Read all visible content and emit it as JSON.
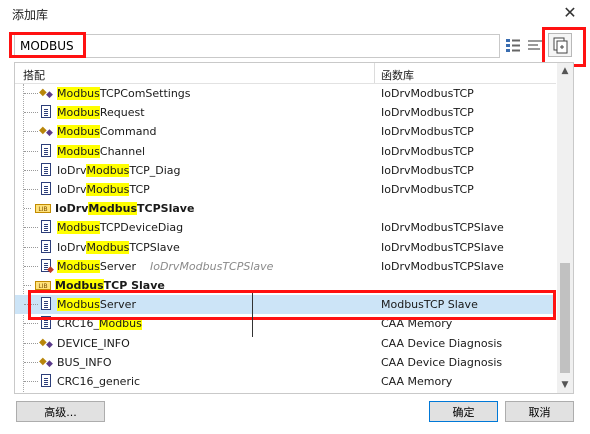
{
  "window": {
    "title": "添加库",
    "close_glyph": "✕"
  },
  "search": {
    "value": "MODBUS"
  },
  "columns": {
    "name": "搭配",
    "library": "函数库"
  },
  "rows": [
    {
      "prefix": "",
      "match": "Modbus",
      "suffix": "TCPComSettings",
      "library": "IoDrvModbusTCP",
      "icon": "function-block-icon",
      "bold": false
    },
    {
      "prefix": "",
      "match": "Modbus",
      "suffix": "Request",
      "library": "IoDrvModbusTCP",
      "icon": "document-icon",
      "bold": false
    },
    {
      "prefix": "",
      "match": "Modbus",
      "suffix": "Command",
      "library": "IoDrvModbusTCP",
      "icon": "function-block-icon",
      "bold": false
    },
    {
      "prefix": "",
      "match": "Modbus",
      "suffix": "Channel",
      "library": "IoDrvModbusTCP",
      "icon": "document-icon",
      "bold": false
    },
    {
      "prefix": "IoDrv",
      "match": "Modbus",
      "suffix": "TCP_Diag",
      "library": "IoDrvModbusTCP",
      "icon": "document-icon",
      "bold": false
    },
    {
      "prefix": "IoDrv",
      "match": "Modbus",
      "suffix": "TCP",
      "library": "IoDrvModbusTCP",
      "icon": "document-icon",
      "bold": false
    },
    {
      "prefix": "IoDrv",
      "match": "Modbus",
      "suffix": "TCPSlave",
      "library": "",
      "icon": "library-icon",
      "bold": true
    },
    {
      "prefix": "",
      "match": "Modbus",
      "suffix": "TCPDeviceDiag",
      "library": "IoDrvModbusTCPSlave",
      "icon": "document-icon",
      "bold": false
    },
    {
      "prefix": "IoDrv",
      "match": "Modbus",
      "suffix": "TCPSlave",
      "library": "IoDrvModbusTCPSlave",
      "icon": "document-icon",
      "bold": false
    },
    {
      "prefix": "",
      "match": "Modbus",
      "suffix": "Server",
      "sub": "IoDrvModbusTCPSlave",
      "library": "IoDrvModbusTCPSlave",
      "icon": "program-icon",
      "bold": false
    },
    {
      "prefix": "",
      "match": "Modbus",
      "suffix": "TCP Slave",
      "library": "",
      "icon": "library-icon",
      "bold": true
    },
    {
      "prefix": "",
      "match": "Modbus",
      "suffix": "Server",
      "library": "ModbusTCP Slave",
      "icon": "document-icon",
      "bold": false,
      "selected": true
    },
    {
      "prefix": "CRC16_",
      "match": "Modbus",
      "suffix": "",
      "library": "CAA Memory",
      "icon": "document-icon",
      "bold": false
    },
    {
      "prefix": "DEVICE_INFO",
      "match": "",
      "suffix": "",
      "library": "CAA Device Diagnosis",
      "icon": "function-block-icon",
      "bold": false
    },
    {
      "prefix": "BUS_INFO",
      "match": "",
      "suffix": "",
      "library": "CAA Device Diagnosis",
      "icon": "function-block-icon",
      "bold": false
    },
    {
      "prefix": "CRC16_generic",
      "match": "",
      "suffix": "",
      "library": "CAA Memory",
      "icon": "document-icon",
      "bold": false
    }
  ],
  "buttons": {
    "advanced": "高级...",
    "ok": "确定",
    "cancel": "取消"
  },
  "library_icon_text": "LIB",
  "colors": {
    "highlight": "#ffff00",
    "annotation": "#ff1111",
    "selection": "#cce4f7"
  }
}
